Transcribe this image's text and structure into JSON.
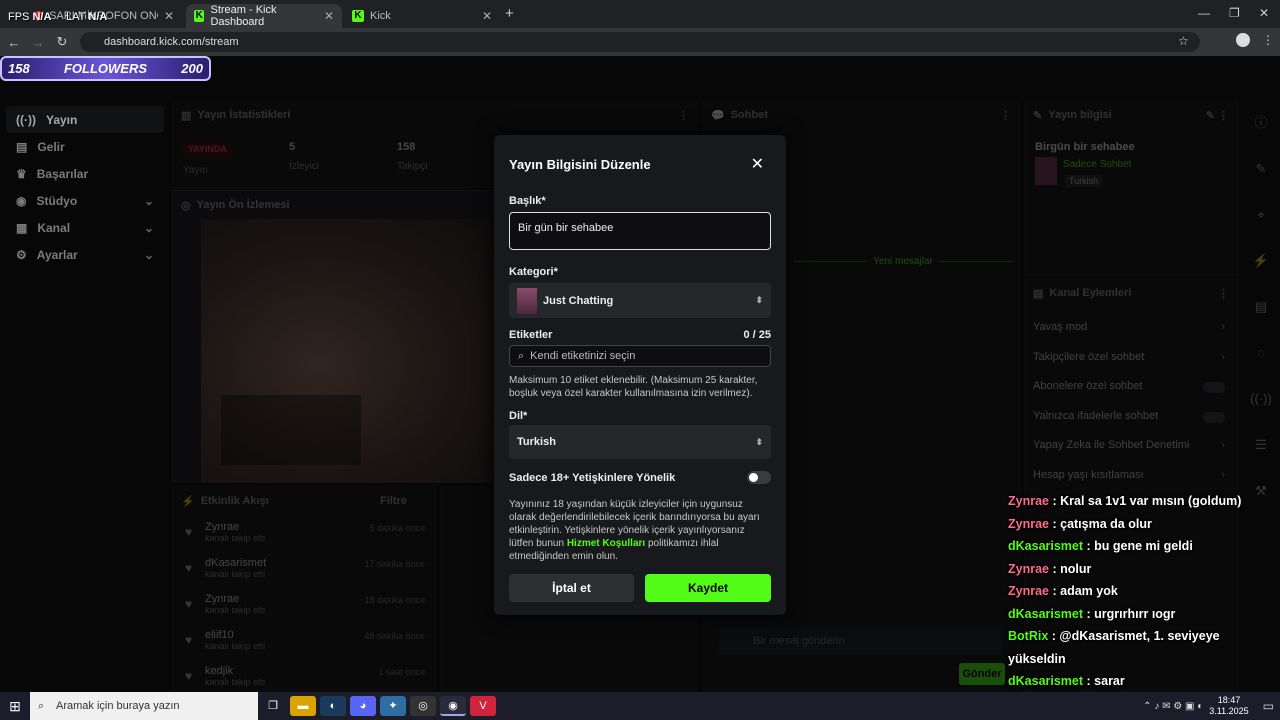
{
  "browser": {
    "tabs": [
      {
        "label": "SARI MİKROFON ONCE SAID -"
      },
      {
        "label": "Stream - Kick Dashboard"
      },
      {
        "label": "Kick"
      }
    ],
    "fps": "FPS",
    "na1": "N/A",
    "lat": "LAT",
    "na2": "N/A",
    "url": "dashboard.kick.com/stream"
  },
  "followers_overlay": {
    "current": "158",
    "label": "FOLLOWERS",
    "goal": "200"
  },
  "sidebar": {
    "items": [
      {
        "label": "Yayın"
      },
      {
        "label": "Gelir"
      },
      {
        "label": "Başarılar"
      },
      {
        "label": "Stüdyo"
      },
      {
        "label": "Kanal"
      },
      {
        "label": "Ayarlar"
      }
    ]
  },
  "stats": {
    "title": "Yayın İstatistikleri",
    "live": "YAYINDA",
    "live_sub": "Yayın",
    "viewers": "5",
    "viewers_label": "İzleyici",
    "followers": "158",
    "followers_label": "Takipçi"
  },
  "preview": {
    "title": "Yayın Ön İzlemesi"
  },
  "activity": {
    "title": "Etkinlik Akışı",
    "filter": "Filtre",
    "items": [
      {
        "name": "Zynrae",
        "sub": "kanalı takip etti",
        "time": "5 dakika önce"
      },
      {
        "name": "dKasarismet",
        "sub": "kanalı takip etti",
        "time": "17 dakika önce"
      },
      {
        "name": "Zynrae",
        "sub": "kanalı takip etti",
        "time": "18 dakika önce"
      },
      {
        "name": "eliif10",
        "sub": "kanalı takip etti",
        "time": "48 dakika önce"
      },
      {
        "name": "kedjik",
        "sub": "kanalı takip etti",
        "time": "1 saat önce"
      }
    ]
  },
  "chat": {
    "title": "Sohbet",
    "new_msgs": "Yeni mesajlar",
    "placeholder": "Bir mesaj gönderin",
    "send": "Gönder"
  },
  "stream_info": {
    "title": "Yayın bilgisi",
    "stream_title": "Birgün bir sehabee",
    "category": "Sadece Sohbet",
    "lang": "Turkish"
  },
  "channel_actions": {
    "title": "Kanal Eylemleri",
    "items": [
      {
        "label": "Yavaş mod"
      },
      {
        "label": "Takipçilere özel sohbet"
      },
      {
        "label": "Abonelere özel sohbet"
      },
      {
        "label": "Yalnızca ifadelerle sohbet"
      },
      {
        "label": "Yapay Zeka ile Sohbet Denetimi"
      },
      {
        "label": "Hesap yaşı kısıtlaması"
      }
    ]
  },
  "modal": {
    "title": "Yayın Bilgisini Düzenle",
    "title_label": "Başlık*",
    "title_value": "Bir gün bir sehabee",
    "category_label": "Kategori*",
    "category_value": "Just Chatting",
    "tags_label": "Etiketler",
    "tags_count": "0 / 25",
    "tags_placeholder": "Kendi etiketinizi seçin",
    "tags_help": "Maksimum 10 etiket eklenebilir. (Maksimum 25 karakter, boşluk veya özel karakter kullanılmasına izin verilmez).",
    "lang_label": "Dil*",
    "lang_value": "Turkish",
    "adult_label": "Sadece 18+ Yetişkinlere Yönelik",
    "adult_help_1": "Yayınınız 18 yaşından küçük izleyiciler için uygunsuz olarak değerlendirilebilecek içerik barındırıyorsa bu ayarı etkinleştirin. Yetişkinlere yönelik içerik yayınlıyorsanız lütfen bunun ",
    "adult_help_link": "Hizmet Koşulları",
    "adult_help_2": " politikamızı ihlal etmediğinden emin olun.",
    "cancel": "İptal et",
    "save": "Kaydet"
  },
  "chat_overlay": [
    {
      "user": "Zynrae",
      "msg": ": Kral sa 1v1 var mısın (goldum)",
      "color": "#ff6b8b"
    },
    {
      "user": "Zynrae",
      "msg": ": çatışma da olur",
      "color": "#ff6b8b"
    },
    {
      "user": "dKasarismet",
      "msg": ": bu gene mi geldi",
      "color": "#53fc18"
    },
    {
      "user": "Zynrae",
      "msg": ": nolur",
      "color": "#ff6b8b"
    },
    {
      "user": "Zynrae",
      "msg": ": adam yok",
      "color": "#ff6b8b"
    },
    {
      "user": "dKasarismet",
      "msg": ": urgrırhırr ıogr",
      "color": "#53fc18"
    },
    {
      "user": "BotRix",
      "msg": ": @dKasarismet, 1. seviyeye yükseldin",
      "color": "#53fc18"
    },
    {
      "user": "dKasarismet",
      "msg": ": sarar",
      "color": "#53fc18"
    }
  ],
  "taskbar": {
    "search": "Aramak için buraya yazın",
    "time": "18:47",
    "date": "3.11.2025"
  }
}
